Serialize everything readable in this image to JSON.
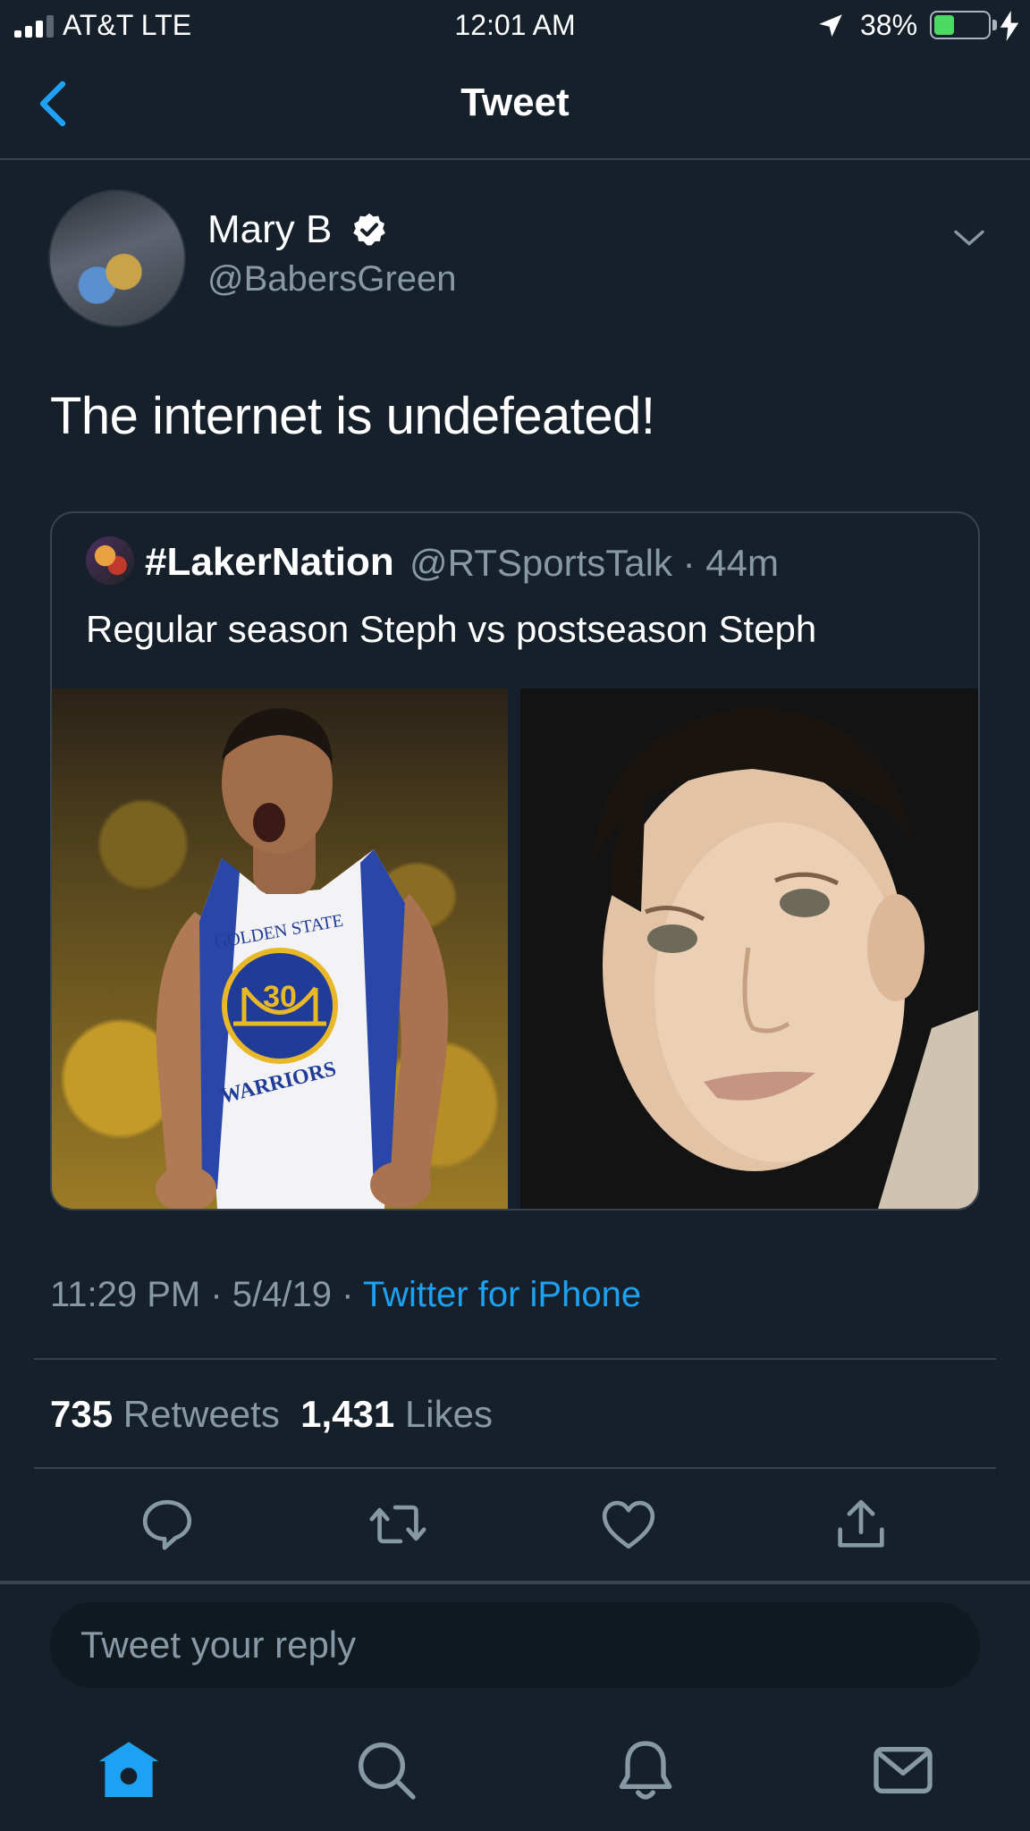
{
  "status_bar": {
    "carrier": "AT&T  LTE",
    "time": "12:01 AM",
    "battery_percent": "38%",
    "battery_level": 0.38,
    "signal_bars": 3
  },
  "nav": {
    "title": "Tweet"
  },
  "tweet": {
    "author_name": "Mary B",
    "author_handle": "@BabersGreen",
    "text": "The internet is undefeated!",
    "timestamp": "11:29 PM · 5/4/19 · ",
    "source": "Twitter for iPhone",
    "retweets_count": "735",
    "retweets_label": "Retweets",
    "likes_count": "1,431",
    "likes_label": "Likes"
  },
  "quoted": {
    "name": "#LakerNation",
    "handle": "@RTSportsTalk · 44m",
    "text": "Regular season Steph vs postseason Steph",
    "jersey_text": "GOLDEN STATE",
    "jersey_number": "30",
    "jersey_team": "WARRIORS"
  },
  "reply": {
    "placeholder": "Tweet your reply"
  },
  "colors": {
    "background": "#15202b",
    "accent": "#1da1f2",
    "secondary_text": "#8899a6",
    "divider": "#38444d"
  },
  "icons": [
    "chevron-left-icon",
    "verified-icon",
    "chevron-down-icon",
    "reply-icon",
    "retweet-icon",
    "like-icon",
    "share-icon",
    "home-icon",
    "search-icon",
    "notifications-icon",
    "messages-icon"
  ]
}
